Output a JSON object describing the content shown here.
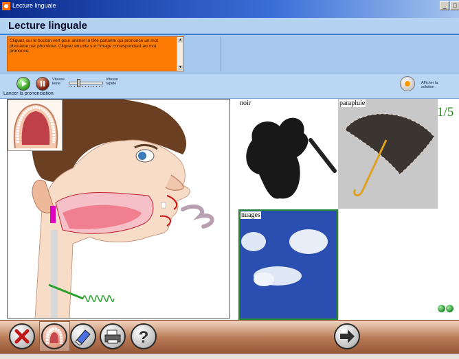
{
  "window": {
    "title": "Lecture linguale",
    "minimize_label": "_",
    "maximize_label": "□"
  },
  "header": {
    "title": "Lecture linguale"
  },
  "instructions": {
    "text": "Cliquez sur le bouton vert pour animer la tête parlante qui prononce un mot phonème par phonème. Cliquez ensuite sur l'image correspondant au mot prononcé."
  },
  "controls": {
    "speed_slow_label": "Vitesse lente",
    "speed_fast_label": "Vitesse rapide",
    "speed_level": 0.25,
    "launch_label": "Lancer la prononciation",
    "solution_label": "Afficher la solution"
  },
  "cards": [
    {
      "caption": "noir"
    },
    {
      "caption": "parapluie"
    },
    {
      "caption": "nuages"
    },
    {
      "caption": ""
    }
  ],
  "progress": {
    "text": "1/5"
  },
  "colors": {
    "accent": "#ff7a00",
    "header": "#b4d2f2",
    "progress": "#2a8a1a",
    "selected_card_border": "#2a8a3a"
  },
  "toolbar_icons": [
    "close-icon",
    "palate-icon",
    "eraser-icon",
    "printer-icon",
    "help-icon",
    "next-arrow-icon"
  ]
}
